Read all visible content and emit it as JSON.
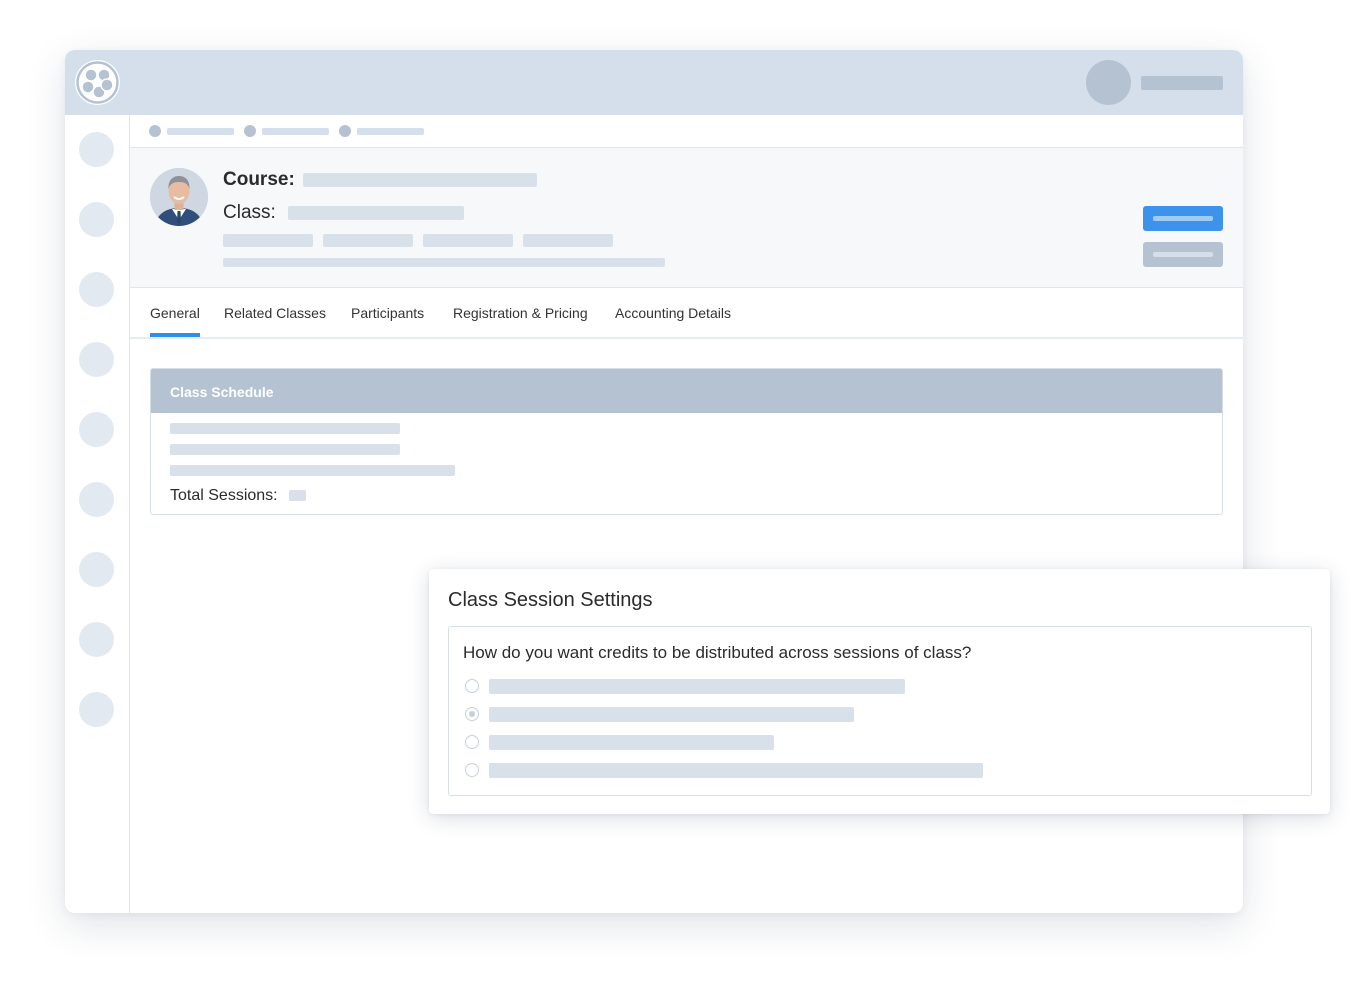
{
  "header": {
    "course_label": "Course:",
    "class_label": "Class:"
  },
  "tabs": [
    {
      "label": "General",
      "active": true
    },
    {
      "label": "Related Classes",
      "active": false
    },
    {
      "label": "Participants",
      "active": false
    },
    {
      "label": "Registration & Pricing",
      "active": false
    },
    {
      "label": "Accounting Details",
      "active": false
    }
  ],
  "class_schedule": {
    "title": "Class Schedule",
    "total_sessions_label": "Total Sessions:"
  },
  "modal": {
    "title": "Class Session Settings",
    "question": "How do you want credits to be distributed across sessions of class?",
    "selected_option_index": 1
  },
  "colors": {
    "accent": "#2f8fe6",
    "primary_button": "#3d93ec",
    "topbar": "#d4dfeb",
    "panel_header": "#b5c2d1"
  }
}
